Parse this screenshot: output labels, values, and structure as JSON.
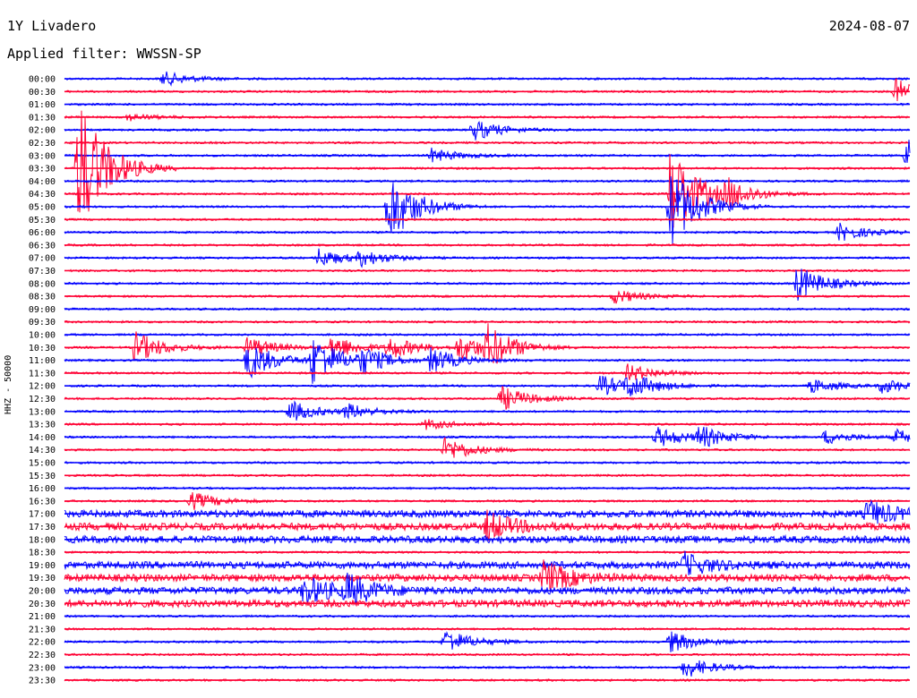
{
  "header": {
    "station": "1Y Livadero",
    "date": "2024-08-07",
    "filter": "Applied filter: WWSSN-SP"
  },
  "chart_data": {
    "type": "line",
    "title": "1Y Livadero",
    "ylabel": "HHZ - 50000",
    "row_labels": [
      "00:00",
      "00:30",
      "01:00",
      "01:30",
      "02:00",
      "02:30",
      "03:00",
      "03:30",
      "04:00",
      "04:30",
      "05:00",
      "05:30",
      "06:00",
      "06:30",
      "07:00",
      "07:30",
      "08:00",
      "08:30",
      "09:00",
      "09:30",
      "10:00",
      "10:30",
      "11:00",
      "11:30",
      "12:00",
      "12:30",
      "13:00",
      "13:30",
      "14:00",
      "14:30",
      "15:00",
      "15:30",
      "16:00",
      "16:30",
      "17:00",
      "17:30",
      "18:00",
      "18:30",
      "19:00",
      "19:30",
      "20:00",
      "20:30",
      "21:00",
      "21:30",
      "22:00",
      "22:30",
      "23:00",
      "23:30"
    ],
    "row_minutes": 30,
    "series_colors": [
      "#0000ff",
      "#ff0033"
    ],
    "colors": {
      "blue": "#0000ff",
      "red": "#ff0033"
    },
    "events": [
      {
        "row": 0,
        "minute": 3.5,
        "amp": 8
      },
      {
        "row": 1,
        "minute": 29.5,
        "amp": 14
      },
      {
        "row": 3,
        "minute": 2.2,
        "amp": 4
      },
      {
        "row": 4,
        "minute": 14.5,
        "amp": 12
      },
      {
        "row": 6,
        "minute": 13.0,
        "amp": 8
      },
      {
        "row": 6,
        "minute": 29.9,
        "amp": 22
      },
      {
        "row": 7,
        "minute": 0.5,
        "amp": 80
      },
      {
        "row": 9,
        "minute": 21.5,
        "amp": 55
      },
      {
        "row": 9,
        "minute": 23.5,
        "amp": 14
      },
      {
        "row": 10,
        "minute": 11.5,
        "amp": 42
      },
      {
        "row": 10,
        "minute": 21.5,
        "amp": 45
      },
      {
        "row": 12,
        "minute": 27.5,
        "amp": 10
      },
      {
        "row": 14,
        "minute": 9.0,
        "amp": 10
      },
      {
        "row": 14,
        "minute": 10.5,
        "amp": 8
      },
      {
        "row": 16,
        "minute": 26.0,
        "amp": 20
      },
      {
        "row": 17,
        "minute": 19.5,
        "amp": 8
      },
      {
        "row": 21,
        "minute": 2.5,
        "amp": 18
      },
      {
        "row": 21,
        "minute": 6.5,
        "amp": 12
      },
      {
        "row": 21,
        "minute": 9.5,
        "amp": 14
      },
      {
        "row": 21,
        "minute": 11.5,
        "amp": 12
      },
      {
        "row": 21,
        "minute": 14.0,
        "amp": 16
      },
      {
        "row": 21,
        "minute": 15.0,
        "amp": 22
      },
      {
        "row": 22,
        "minute": 6.5,
        "amp": 22
      },
      {
        "row": 22,
        "minute": 8.8,
        "amp": 28
      },
      {
        "row": 22,
        "minute": 10.5,
        "amp": 14
      },
      {
        "row": 22,
        "minute": 13.0,
        "amp": 14
      },
      {
        "row": 23,
        "minute": 20.0,
        "amp": 10
      },
      {
        "row": 24,
        "minute": 19.0,
        "amp": 12
      },
      {
        "row": 24,
        "minute": 20.0,
        "amp": 12
      },
      {
        "row": 24,
        "minute": 26.5,
        "amp": 8
      },
      {
        "row": 24,
        "minute": 29.0,
        "amp": 8
      },
      {
        "row": 25,
        "minute": 15.5,
        "amp": 14
      },
      {
        "row": 26,
        "minute": 8.0,
        "amp": 12
      },
      {
        "row": 26,
        "minute": 10.0,
        "amp": 8
      },
      {
        "row": 27,
        "minute": 12.8,
        "amp": 6
      },
      {
        "row": 28,
        "minute": 21.0,
        "amp": 12
      },
      {
        "row": 28,
        "minute": 22.5,
        "amp": 12
      },
      {
        "row": 28,
        "minute": 27.0,
        "amp": 8
      },
      {
        "row": 28,
        "minute": 29.5,
        "amp": 8
      },
      {
        "row": 29,
        "minute": 13.5,
        "amp": 14
      },
      {
        "row": 33,
        "minute": 4.5,
        "amp": 10
      },
      {
        "row": 34,
        "minute": 28.5,
        "amp": 14
      },
      {
        "row": 35,
        "minute": 15.0,
        "amp": 16
      },
      {
        "row": 38,
        "minute": 22.0,
        "amp": 12
      },
      {
        "row": 39,
        "minute": 17.0,
        "amp": 18
      },
      {
        "row": 40,
        "minute": 8.5,
        "amp": 16
      },
      {
        "row": 40,
        "minute": 10.0,
        "amp": 16
      },
      {
        "row": 44,
        "minute": 13.5,
        "amp": 14
      },
      {
        "row": 44,
        "minute": 21.5,
        "amp": 12
      },
      {
        "row": 46,
        "minute": 22.0,
        "amp": 12
      }
    ],
    "noisy_rows": [
      34,
      35,
      36,
      38,
      39,
      40,
      41
    ]
  }
}
